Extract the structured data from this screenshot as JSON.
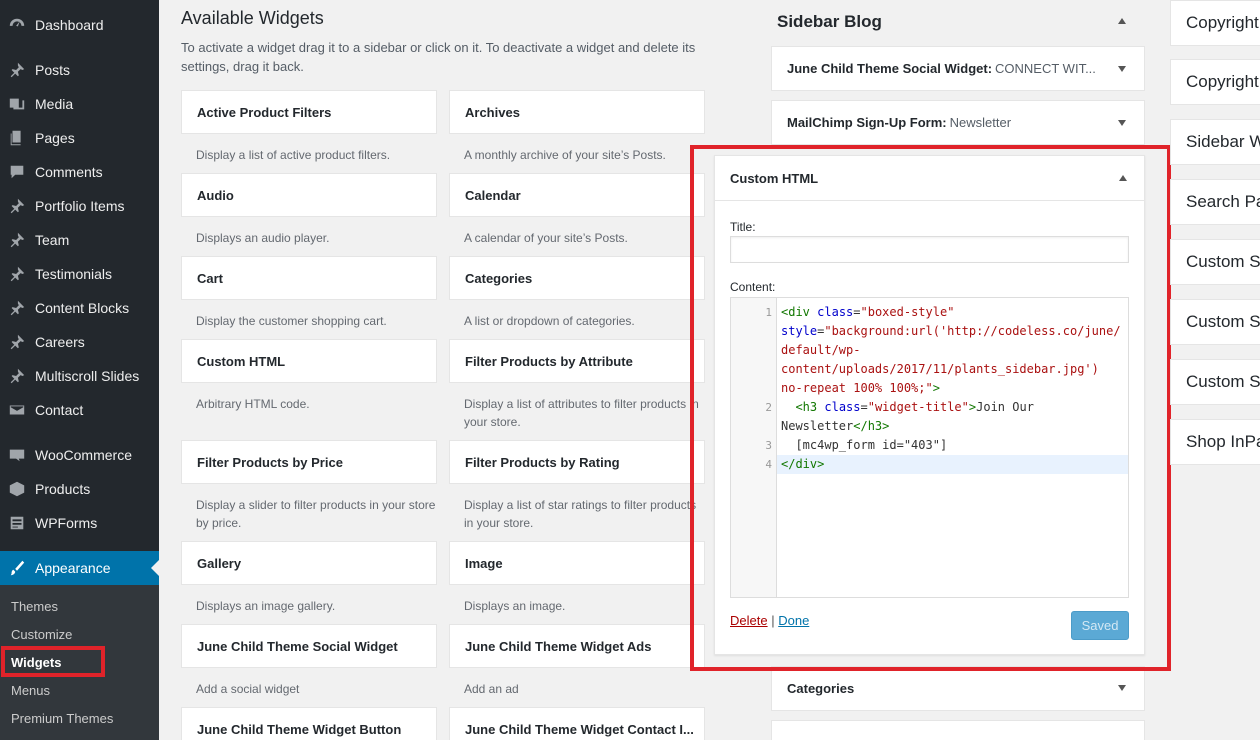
{
  "sidebar": {
    "items": [
      {
        "label": "Dashboard",
        "icon": "dashboard-icon"
      },
      {
        "label": "Posts",
        "icon": "pin-icon"
      },
      {
        "label": "Media",
        "icon": "media-icon"
      },
      {
        "label": "Pages",
        "icon": "pages-icon"
      },
      {
        "label": "Comments",
        "icon": "comments-icon"
      },
      {
        "label": "Portfolio Items",
        "icon": "pin-icon"
      },
      {
        "label": "Team",
        "icon": "pin-icon"
      },
      {
        "label": "Testimonials",
        "icon": "pin-icon"
      },
      {
        "label": "Content Blocks",
        "icon": "pin-icon"
      },
      {
        "label": "Careers",
        "icon": "pin-icon"
      },
      {
        "label": "Multiscroll Slides",
        "icon": "pin-icon"
      },
      {
        "label": "Contact",
        "icon": "envelope-icon"
      },
      {
        "label": "WooCommerce",
        "icon": "woo-icon"
      },
      {
        "label": "Products",
        "icon": "box-icon"
      },
      {
        "label": "WPForms",
        "icon": "form-icon"
      },
      {
        "label": "Appearance",
        "icon": "brush-icon"
      }
    ],
    "submenu": [
      "Themes",
      "Customize",
      "Widgets",
      "Menus",
      "Premium Themes"
    ],
    "accent": "#0073aa"
  },
  "available": {
    "title": "Available Widgets",
    "description": "To activate a widget drag it to a sidebar or click on it. To deactivate a widget and delete its settings, drag it back.",
    "widgets": [
      {
        "name": "Active Product Filters",
        "desc": "Display a list of active product filters."
      },
      {
        "name": "Archives",
        "desc": "A monthly archive of your site’s Posts."
      },
      {
        "name": "Audio",
        "desc": "Displays an audio player."
      },
      {
        "name": "Calendar",
        "desc": "A calendar of your site’s Posts."
      },
      {
        "name": "Cart",
        "desc": "Display the customer shopping cart."
      },
      {
        "name": "Categories",
        "desc": "A list or dropdown of categories."
      },
      {
        "name": "Custom HTML",
        "desc": "Arbitrary HTML code."
      },
      {
        "name": "Filter Products by Attribute",
        "desc": "Display a list of attributes to filter products in your store."
      },
      {
        "name": "Filter Products by Price",
        "desc": "Display a slider to filter products in your store by price."
      },
      {
        "name": "Filter Products by Rating",
        "desc": "Display a list of star ratings to filter products in your store."
      },
      {
        "name": "Gallery",
        "desc": "Displays an image gallery."
      },
      {
        "name": "Image",
        "desc": "Displays an image."
      },
      {
        "name": "June Child Theme Social Widget",
        "desc": "Add a social widget"
      },
      {
        "name": "June Child Theme Widget Ads",
        "desc": "Add an ad"
      },
      {
        "name": "June Child Theme Widget Button",
        "desc": ""
      },
      {
        "name": "June Child Theme Widget Contact I...",
        "desc": ""
      }
    ]
  },
  "sidebar_blog": {
    "title": "Sidebar Blog",
    "widgets": [
      {
        "title": "June Child Theme Social Widget:",
        "subtitle": "CONNECT WIT..."
      },
      {
        "title": "MailChimp Sign-Up Form:",
        "subtitle": "Newsletter"
      }
    ],
    "after": [
      {
        "title": "Categories",
        "subtitle": ""
      }
    ]
  },
  "custom_html": {
    "header": "Custom HTML",
    "title_label": "Title:",
    "title_value": "",
    "content_label": "Content:",
    "line_numbers": [
      "1",
      "2",
      "3",
      "4"
    ],
    "code": {
      "l1a_tag": "<div",
      "l1a_attr": "class",
      "l1a_eq": "=",
      "l1a_val": "\"boxed-style\"",
      "l1b_attr": "style",
      "l1b_eq": "=",
      "l1b_val": "\"background:url('http://codeless.co/june/",
      "l1c": "default/wp-",
      "l1d": "content/uploads/2017/11/plants_sidebar.jpg')",
      "l1e_val": "no-repeat 100% 100%;\"",
      "l1e_tag": ">",
      "l2a_tag": "<h3",
      "l2a_attr": "class",
      "l2a_eq": "=",
      "l2a_val": "\"widget-title\"",
      "l2a_tagclose": ">",
      "l2a_text": "Join Our",
      "l2b_text": "Newsletter",
      "l2b_tag": "</h3>",
      "l3": "[mc4wp_form id=\"403\"]",
      "l4": "</div>"
    },
    "delete_label": "Delete",
    "separator": "|",
    "done_label": "Done",
    "saved_label": "Saved"
  },
  "right_column": {
    "items": [
      "Copyright",
      "Copyright",
      "Sidebar W",
      "Search Pa",
      "Custom Si",
      "Custom Si",
      "Custom Si",
      "Shop InPa"
    ]
  },
  "highlight_color": "#e0232a"
}
